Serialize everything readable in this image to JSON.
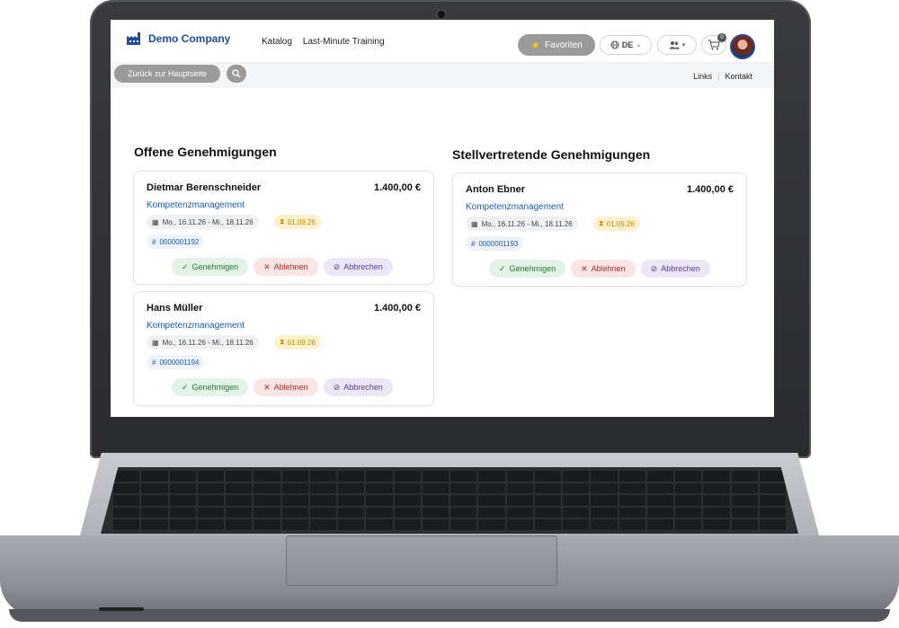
{
  "app": {
    "brand": "Demo Company",
    "nav": [
      "Katalog",
      "Last-Minute Training"
    ],
    "favorites_label": "Favoriten",
    "language": "DE",
    "cart_count": "0"
  },
  "subbar": {
    "back_label": "Zurück zur Hauptseite",
    "links": [
      "Links",
      "Kontakt"
    ]
  },
  "sections": {
    "open_title": "Offene Genehmigungen",
    "deputy_title": "Stellvertretende Genehmigungen"
  },
  "actions": {
    "approve": "Genehmigen",
    "reject": "Ablehnen",
    "cancel": "Abbrechen"
  },
  "open_cards": [
    {
      "name": "Dietmar Berenschneider",
      "amount": "1.400,00 €",
      "category": "Kompetenzmanagement",
      "date_range": "Mo., 16.11.26 - Mi., 18.11.26",
      "deadline": "01.09.26",
      "id": "0000001192"
    },
    {
      "name": "Hans Müller",
      "amount": "1.400,00 €",
      "category": "Kompetenzmanagement",
      "date_range": "Mo., 16.11.26 - Mi., 18.11.26",
      "deadline": "01.09.26",
      "id": "0000001194"
    }
  ],
  "deputy_cards": [
    {
      "name": "Anton Ebner",
      "amount": "1.400,00 €",
      "category": "Kompetenzmanagement",
      "date_range": "Mo., 16.11.26 - Mi., 18.11.26",
      "deadline": "01.09.26",
      "id": "0000001193"
    }
  ],
  "colors": {
    "brand": "#1c4ea5",
    "approve": "#1f7a36",
    "reject": "#b52a2a",
    "cancel": "#5a3d9e",
    "deadline": "#c28a00"
  }
}
